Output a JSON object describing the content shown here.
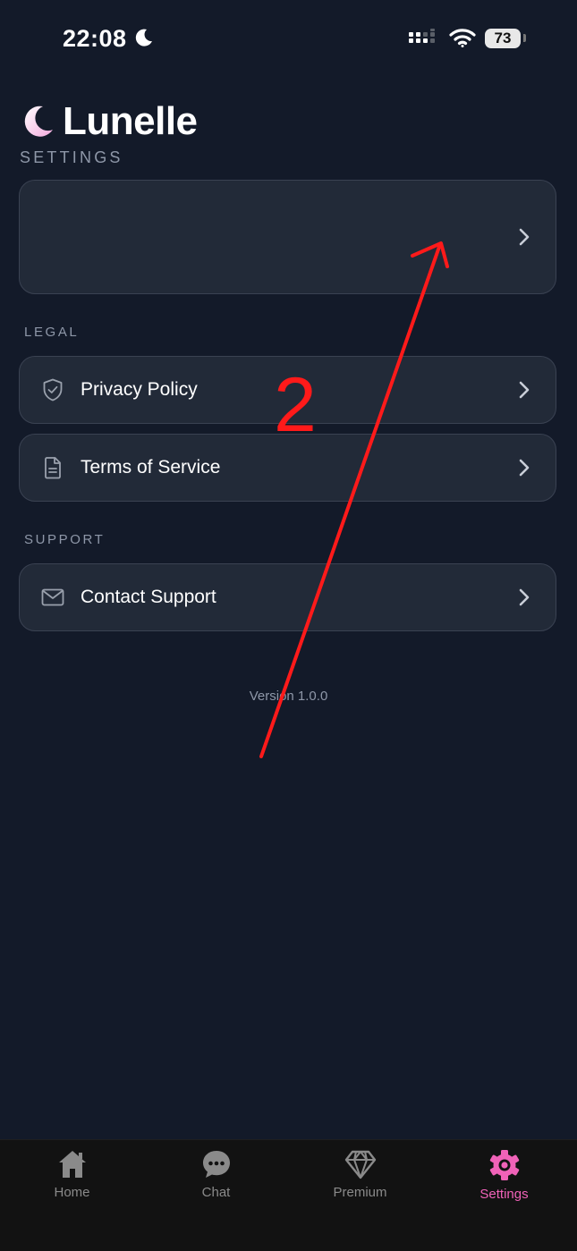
{
  "status_bar": {
    "time": "22:08",
    "battery": "73"
  },
  "header": {
    "app_name": "Lunelle",
    "section_title": "SETTINGS"
  },
  "profile_card": {
    "label": ""
  },
  "sections": {
    "legal": {
      "title": "LEGAL",
      "items": [
        {
          "label": "Privacy Policy",
          "icon": "shield-check-icon"
        },
        {
          "label": "Terms of Service",
          "icon": "document-icon"
        }
      ]
    },
    "support": {
      "title": "SUPPORT",
      "items": [
        {
          "label": "Contact Support",
          "icon": "mail-icon"
        }
      ]
    }
  },
  "version": "Version 1.0.0",
  "annotation": {
    "number": "2",
    "color": "#ff1a1a"
  },
  "tabbar": {
    "tabs": [
      {
        "label": "Home",
        "icon": "home-icon"
      },
      {
        "label": "Chat",
        "icon": "chat-icon"
      },
      {
        "label": "Premium",
        "icon": "diamond-icon"
      },
      {
        "label": "Settings",
        "icon": "gear-icon",
        "active": true
      }
    ],
    "active_color": "#f062b8"
  },
  "colors": {
    "background": "#131a29",
    "card": "#222a38",
    "accent": "#f062b8"
  }
}
